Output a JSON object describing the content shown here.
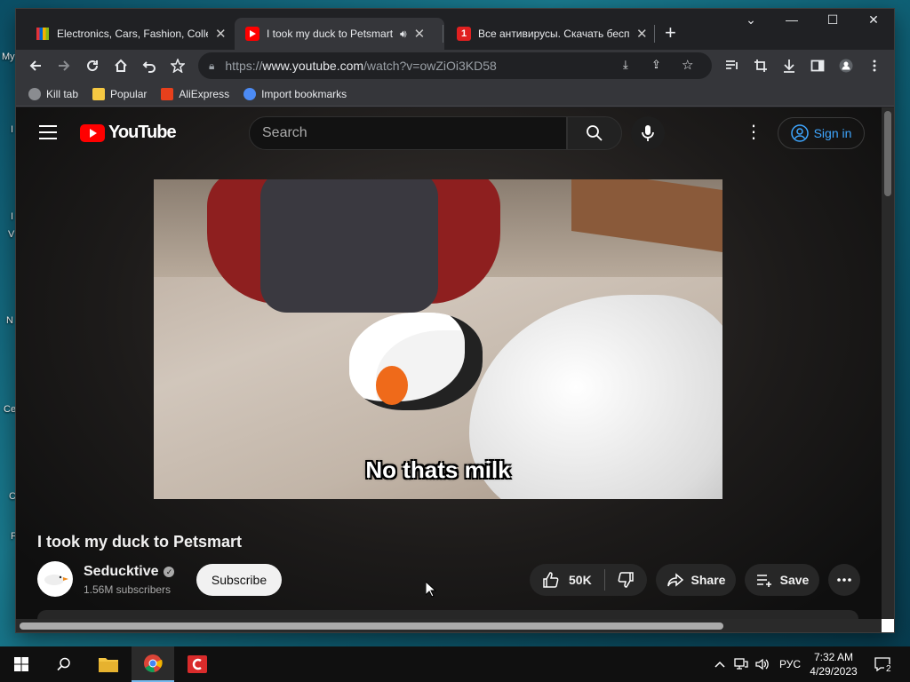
{
  "desktop": {
    "fragments": [
      "My",
      "I",
      "I",
      "V",
      "N",
      "Ce",
      "C",
      "F"
    ]
  },
  "browser": {
    "tabs": [
      {
        "title": "Electronics, Cars, Fashion, Collect",
        "favicon": "ebay-icon",
        "active": false
      },
      {
        "title": "I took my duck to Petsmart -",
        "favicon": "youtube-icon",
        "active": true,
        "audio": true
      },
      {
        "title": "Все антивирусы. Скачать беспл",
        "favicon": "antivirus-site-icon",
        "active": false
      }
    ],
    "new_tab_label": "+",
    "window_controls": {
      "list": "⌄",
      "minimize": "—",
      "maximize": "☐",
      "close": "✕"
    },
    "url": {
      "scheme": "https://",
      "host": "www.youtube.com",
      "path": "/watch?v=owZiOi3KD58"
    },
    "bookmarks": [
      {
        "label": "Kill tab",
        "icon": "globe-icon"
      },
      {
        "label": "Popular",
        "icon": "folder-icon"
      },
      {
        "label": "AliExpress",
        "icon": "aliexpress-icon"
      },
      {
        "label": "Import bookmarks",
        "icon": "gear-icon"
      }
    ]
  },
  "youtube": {
    "logo_text": "YouTube",
    "search_placeholder": "Search",
    "sign_in_label": "Sign in",
    "video": {
      "caption": "No thats milk",
      "title": "I took my duck to Petsmart"
    },
    "channel": {
      "name": "Seducktive",
      "subscribers": "1.56M subscribers",
      "verified": true
    },
    "subscribe_label": "Subscribe",
    "likes": "50K",
    "share_label": "Share",
    "save_label": "Save"
  },
  "taskbar": {
    "language": "РУС",
    "time": "7:32 AM",
    "date": "4/29/2023",
    "notifications": "2"
  }
}
